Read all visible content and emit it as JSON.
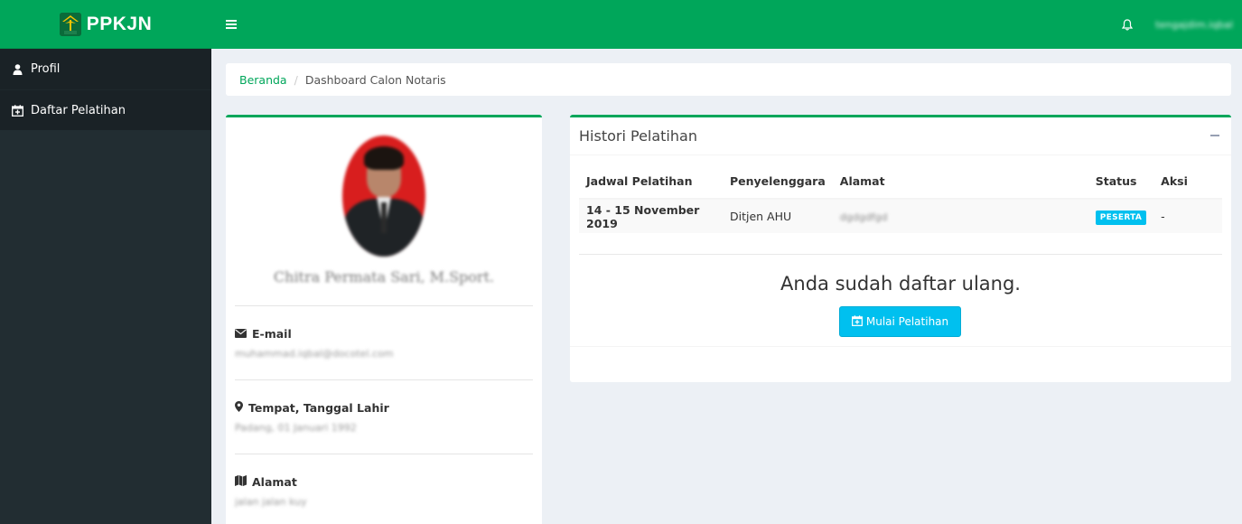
{
  "app": {
    "logo_text": "PPKJN",
    "user_name": "tengajdim.iqbal",
    "icons": {
      "menu": "hamburger-icon",
      "bell": "bell-icon",
      "logo": "emblem-icon"
    },
    "colors": {
      "primary": "#00a65a",
      "sidebar": "#222d32",
      "info": "#00c0ef"
    }
  },
  "sidebar": {
    "items": [
      {
        "label": "Profil",
        "icon": "user-icon"
      },
      {
        "label": "Daftar Pelatihan",
        "icon": "calendar-plus-icon"
      }
    ]
  },
  "breadcrumb": {
    "home": "Beranda",
    "separator": "/",
    "current": "Dashboard Calon Notaris"
  },
  "profile": {
    "name": "Chitra Permata Sari, M.Sport.",
    "email_label": "E-mail",
    "email_value": "muhammad.iqbal@docotel.com",
    "birth_label": "Tempat, Tanggal Lahir",
    "birth_value": "Padang, 01 Januari 1992",
    "address_label": "Alamat",
    "address_value": "jalan jalan kuy"
  },
  "history": {
    "title": "Histori Pelatihan",
    "columns": [
      "Jadwal Pelatihan",
      "Penyelenggara",
      "Alamat",
      "Status",
      "Aksi"
    ],
    "rows": [
      {
        "date": "14 - 15 November 2019",
        "organizer": "Ditjen AHU",
        "address": "dgdgdfgd",
        "status": "PESERTA",
        "action": "-"
      }
    ],
    "message": "Anda sudah daftar ulang.",
    "start_button": "Mulai Pelatihan"
  }
}
